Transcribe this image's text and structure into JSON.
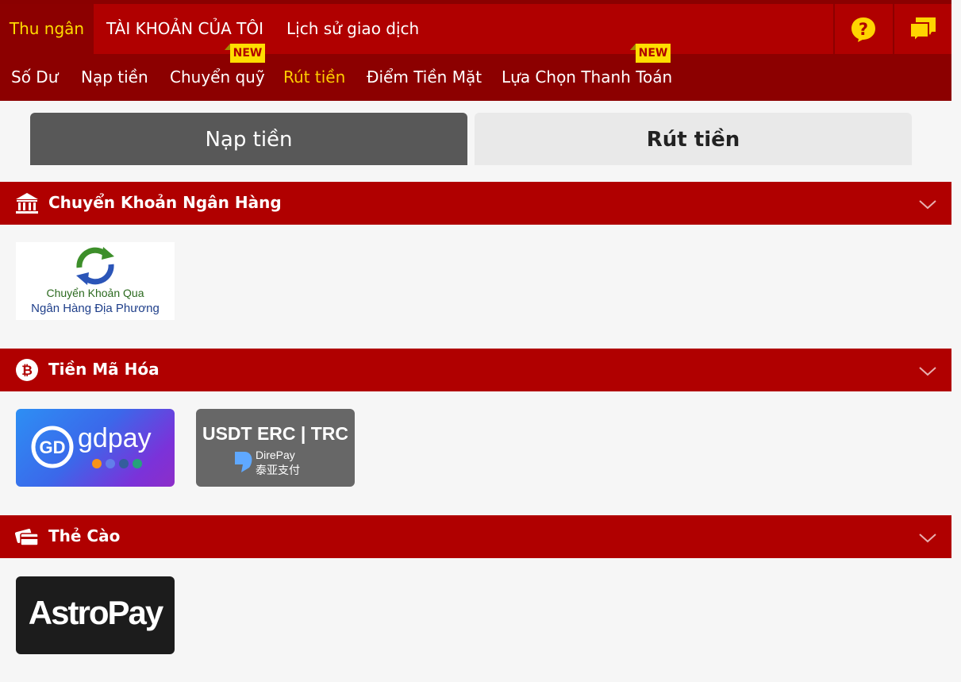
{
  "top_tabs": [
    {
      "label": "Thu ngân",
      "active": true
    },
    {
      "label": "TÀI KHOẢN CỦA TÔI",
      "active": false
    },
    {
      "label": "Lịch sử giao dịch",
      "active": false
    }
  ],
  "top_icons": [
    "help-icon",
    "chat-icon"
  ],
  "subnav": [
    {
      "label": "Số Dư",
      "active": false
    },
    {
      "label": "Nạp tiền",
      "active": false
    },
    {
      "label": "Chuyển quỹ",
      "active": false,
      "badge": "NEW"
    },
    {
      "label": "Rút tiền",
      "active": true
    },
    {
      "label": "Điểm Tiền Mặt",
      "active": false
    },
    {
      "label": "Lựa Chọn Thanh Toán",
      "active": false,
      "badge": "NEW"
    }
  ],
  "toggle": {
    "deposit": "Nạp tiền",
    "withdraw": "Rút tiền"
  },
  "sections": [
    {
      "label": "Chuyển Khoản Ngân Hàng",
      "icon": "bank-icon",
      "methods": [
        {
          "line1": "Chuyển Khoản Qua",
          "line2": "Ngân Hàng Địa Phương"
        }
      ]
    },
    {
      "label": "Tiền Mã Hóa",
      "icon": "bitcoin-icon",
      "methods": [
        {
          "brand": "gdpay"
        },
        {
          "line1": "USDT ERC | TRC",
          "line2": "DirePay",
          "line3": "泰亚支付"
        }
      ]
    },
    {
      "label": "Thẻ Cào",
      "icon": "card-icon",
      "methods": [
        {
          "brand": "AstroPay"
        }
      ]
    }
  ],
  "colors": {
    "primary": "#b00000",
    "dark": "#8c0000",
    "accent": "#ffdd00"
  }
}
